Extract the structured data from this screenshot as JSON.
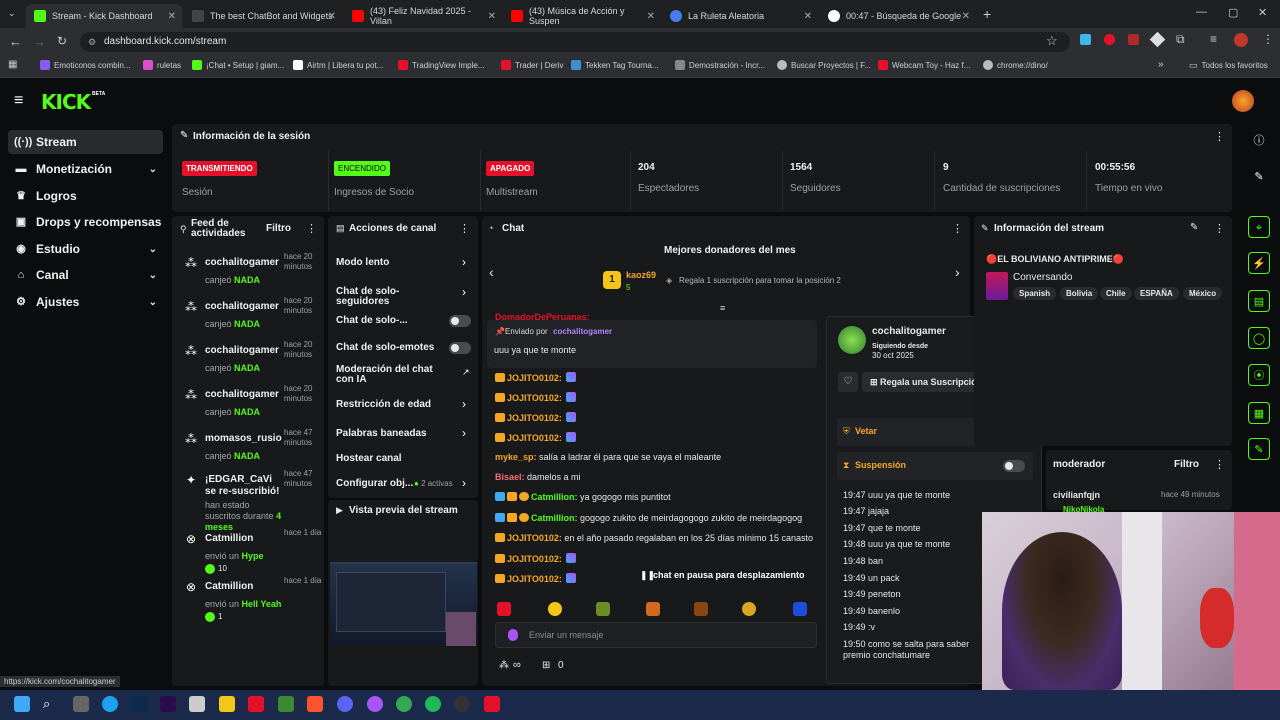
{
  "browser": {
    "tabs": [
      {
        "title": "Stream - Kick Dashboard",
        "color": "#53fc18"
      },
      {
        "title": "The best ChatBot and Widgets",
        "color": "#2b2b2b"
      },
      {
        "title": "(43) Feliz Navidad 2025 - Villan",
        "color": "#ff0000"
      },
      {
        "title": "(43) Música de Acción y Suspen",
        "color": "#ff0000"
      },
      {
        "title": "La Ruleta Aleatoria",
        "color": "#4a7cf0"
      },
      {
        "title": "00:47 - Búsqueda de Google",
        "color": "#ffffff"
      }
    ],
    "url": "dashboard.kick.com/stream",
    "bookmarks": [
      "Emoticonos combin...",
      "ruletas",
      "¡Chat • Setup | giam...",
      "Airtm | Libera tu pot...",
      "TradingView Imple...",
      "Trader | Deriv",
      "Tekken Tag Tourna...",
      "Demostración - Incr...",
      "Buscar Proyectos | F...",
      "Webcam Toy - Haz f...",
      "chrome://dino/"
    ],
    "all_favorites": "Todos los favoritos",
    "status_url": "https://kick.com/cochalitogamer"
  },
  "kick": {
    "logo": "KICK",
    "logo_tag": "BETA",
    "accent": "#53fc18"
  },
  "sidebar": {
    "items": [
      {
        "label": "Stream",
        "icon": "broadcast-icon",
        "chevron": false
      },
      {
        "label": "Monetización",
        "icon": "money-icon",
        "chevron": true
      },
      {
        "label": "Logros",
        "icon": "trophy-icon",
        "chevron": false
      },
      {
        "label": "Drops y recompensas",
        "icon": "gift-icon",
        "chevron": false
      },
      {
        "label": "Estudio",
        "icon": "studio-icon",
        "chevron": true
      },
      {
        "label": "Canal",
        "icon": "channel-icon",
        "chevron": true
      },
      {
        "label": "Ajustes",
        "icon": "gear-icon",
        "chevron": true
      }
    ]
  },
  "session": {
    "title": "Información de la sesión",
    "stats": [
      {
        "badge": "TRANSMITIENDO",
        "label": "Sesión",
        "badge_color": "#e5112b"
      },
      {
        "badge": "ENCENDIDO",
        "label": "Ingresos de Socio",
        "badge_color": "#53fc18"
      },
      {
        "badge": "APAGADO",
        "label": "Multistream",
        "badge_color": "#e5112b"
      },
      {
        "value": "204",
        "label": "Espectadores"
      },
      {
        "value": "1564",
        "label": "Seguidores"
      },
      {
        "value": "9",
        "label": "Cantidad de suscripciones"
      },
      {
        "value": "00:55:56",
        "label": "Tiempo en vivo"
      }
    ]
  },
  "feed": {
    "title": "Feed de actividades",
    "filter": "Filtro",
    "items": [
      {
        "name": "cochalitogamer",
        "pre": "canjeó",
        "hl": "NADA",
        "time": "hace 20 minutos"
      },
      {
        "name": "cochalitogamer",
        "pre": "canjeó",
        "hl": "NADA",
        "time": "hace 20 minutos"
      },
      {
        "name": "cochalitogamer",
        "pre": "canjeó",
        "hl": "NADA",
        "time": "hace 20 minutos"
      },
      {
        "name": "cochalitogamer",
        "pre": "canjeó",
        "hl": "NADA",
        "time": "hace 20 minutos"
      },
      {
        "name": "momasos_rusio",
        "pre": "canjeó",
        "hl": "NADA",
        "time": "hace 47 minutos"
      },
      {
        "name": "¡EDGAR_CaVi se re-suscribió!",
        "pre": "han estado suscritos durante",
        "hl": "4 meses",
        "time": "hace 47 minutos"
      },
      {
        "name": "Catmillion",
        "pre": "envió un",
        "hl": "Hype",
        "extra": "10",
        "time": "hace 1 día"
      },
      {
        "name": "Catmillion",
        "pre": "envió un",
        "hl": "Hell Yeah",
        "extra": "1",
        "time": "hace 1 día"
      }
    ]
  },
  "actions": {
    "title": "Acciones de canal",
    "items": [
      {
        "label": "Modo lento",
        "control": "arrow"
      },
      {
        "label": "Chat de solo-seguidores",
        "control": "arrow"
      },
      {
        "label": "Chat de solo-...",
        "control": "toggle"
      },
      {
        "label": "Chat de solo-emotes",
        "control": "toggle"
      },
      {
        "label": "Moderación del chat con IA",
        "control": "external"
      },
      {
        "label": "Restricción de edad",
        "control": "arrow"
      },
      {
        "label": "Palabras baneadas",
        "control": "arrow"
      },
      {
        "label": "Hostear canal",
        "control": "none"
      },
      {
        "label": "Configurar obj...",
        "control": "arrow",
        "note": "2 activas"
      }
    ],
    "preview_title": "Vista previa del stream"
  },
  "chat": {
    "title": "Chat",
    "donors_title": "Mejores donadores del mes",
    "top_donor": "kaoz69",
    "top_donor_count": "5",
    "gift_prompt": "Regala 1 suscripción para tomar la posición 2",
    "pinned_by_label": "Enviado por",
    "pinned_by": "cochalitogamer",
    "pinned_msg": "uuu ya que te monte",
    "partial_user": "DomadorDePeruanas:",
    "messages": [
      {
        "user": "JOJITO0102:",
        "text": "",
        "color": "#f5a623"
      },
      {
        "user": "JOJITO0102:",
        "text": "",
        "color": "#f5a623"
      },
      {
        "user": "JOJITO0102:",
        "text": "",
        "color": "#f5a623"
      },
      {
        "user": "JOJITO0102:",
        "text": "",
        "color": "#f5a623"
      },
      {
        "user": "myke_sp:",
        "text": "salía a ladrar él para que se vaya el maleante",
        "color": "#f5a623"
      },
      {
        "user": "Bisael:",
        "text": "damelos a mi",
        "color": "#f07178"
      },
      {
        "user": "Catmillion:",
        "text": "ya gogogo mis puntitot",
        "color": "#53fc18"
      },
      {
        "user": "Catmillion:",
        "text": "gogogo zukito de meirdagogogo zukito de meirdagogog",
        "color": "#53fc18"
      },
      {
        "user": "JOJITO0102:",
        "text": "en el año pasado regalaban en los 25 días mínimo 15 canasto",
        "color": "#f5a623"
      },
      {
        "user": "JOJITO0102:",
        "text": "",
        "color": "#f5a623"
      },
      {
        "user": "JOJITO0102:",
        "text": "",
        "color": "#f5a623"
      }
    ],
    "paused": "chat en pausa para desplazamiento",
    "input_placeholder": "Enviar un mensaje",
    "points": "∞",
    "bag_count": "0"
  },
  "user_card": {
    "username": "cochalitogamer",
    "following_label": "Siguiendo desde",
    "following_date": "30 oct 2025",
    "gift_button": "Regala una Suscripción",
    "ban_label": "Vetar",
    "timeout_label": "Suspensión",
    "log": [
      "19:47 uuu ya que te monte",
      "19:47 jajaja",
      "19:47 que te monte",
      "19:48 uuu ya que te monte",
      "19:48 ban",
      "19:49 un pack",
      "19:49 peneton",
      "19:49 banenlo",
      "19:49 :v",
      "19:50 como se salta para saber",
      "premio conchatumare"
    ]
  },
  "stream_info": {
    "title": "Información del stream",
    "stream_title": "🔴EL BOLIVIANO ANTIPRIME🔴",
    "category": "Conversando",
    "tags": [
      "Spanish",
      "Bolivia",
      "Chile",
      "ESPAÑA",
      "México"
    ]
  },
  "mods": {
    "title": "moderador",
    "filter": "Filtro",
    "first": "civilianfqjn",
    "first_time": "hace 49 minutos",
    "second": "NikoNikola"
  }
}
